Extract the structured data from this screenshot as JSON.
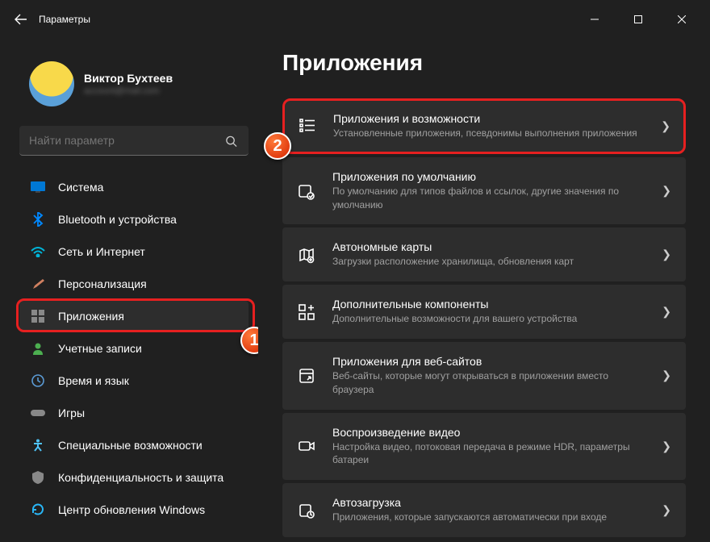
{
  "titlebar": {
    "app_title": "Параметры"
  },
  "profile": {
    "name": "Виктор Бухтеев",
    "sub": "account@mail.com"
  },
  "search": {
    "placeholder": "Найти параметр"
  },
  "sidebar": {
    "items": [
      {
        "label": "Система",
        "icon": "monitor"
      },
      {
        "label": "Bluetooth и устройства",
        "icon": "bluetooth"
      },
      {
        "label": "Сеть и Интернет",
        "icon": "wifi"
      },
      {
        "label": "Персонализация",
        "icon": "brush"
      },
      {
        "label": "Приложения",
        "icon": "apps",
        "active": true
      },
      {
        "label": "Учетные записи",
        "icon": "person"
      },
      {
        "label": "Время и язык",
        "icon": "clock"
      },
      {
        "label": "Игры",
        "icon": "gamepad"
      },
      {
        "label": "Специальные возможности",
        "icon": "accessibility"
      },
      {
        "label": "Конфиденциальность и защита",
        "icon": "shield"
      },
      {
        "label": "Центр обновления Windows",
        "icon": "update"
      }
    ]
  },
  "page": {
    "title": "Приложения"
  },
  "cards": [
    {
      "title": "Приложения и возможности",
      "sub": "Установленные приложения, псевдонимы выполнения приложения",
      "highlighted": true
    },
    {
      "title": "Приложения по умолчанию",
      "sub": "По умолчанию для типов файлов и ссылок, другие значения по умолчанию"
    },
    {
      "title": "Автономные карты",
      "sub": "Загрузки расположение хранилища, обновления карт"
    },
    {
      "title": "Дополнительные компоненты",
      "sub": "Дополнительные возможности для вашего устройства"
    },
    {
      "title": "Приложения для веб-сайтов",
      "sub": "Веб-сайты, которые могут открываться в приложении вместо браузера"
    },
    {
      "title": "Воспроизведение видео",
      "sub": "Настройка видео, потоковая передача в режиме HDR, параметры батареи"
    },
    {
      "title": "Автозагрузка",
      "sub": "Приложения, которые запускаются автоматически при входе"
    }
  ],
  "annotations": {
    "step1": "1",
    "step2": "2"
  }
}
